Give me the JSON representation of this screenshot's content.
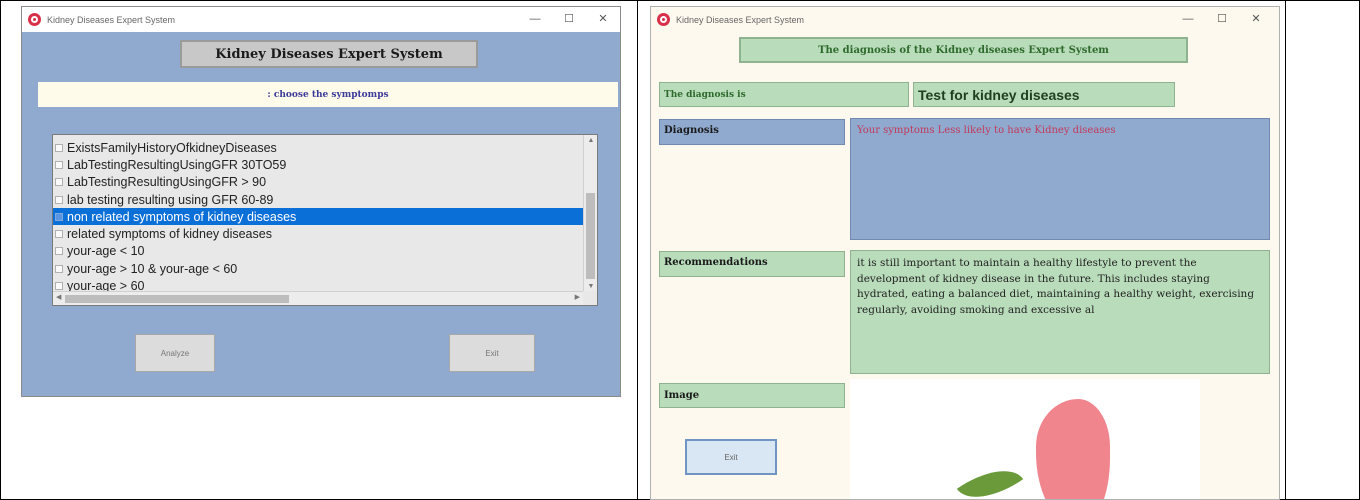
{
  "left_window": {
    "title": "Kidney Diseases Expert System",
    "controls": [
      "—",
      "☐",
      "✕"
    ],
    "heading": "Kidney Diseases Expert System",
    "prompt": ": choose the symptomps",
    "symptoms": [
      "ExistsFamilyHistoryOfkidneyDiseases",
      "LabTestingResultingUsingGFR 30TO59",
      "LabTestingResultingUsingGFR > 90",
      "lab testing resulting using GFR 60-89",
      "non related symptoms of kidney diseases",
      "related symptoms of kidney diseases",
      "your-age < 10",
      "your-age > 10 & your-age < 60",
      "your-age > 60"
    ],
    "selected_index": 4,
    "analyze_label": "Analyze",
    "exit_label": "Exit"
  },
  "right_window": {
    "title": "Kidney Diseases Expert System",
    "controls": [
      "—",
      "☐",
      "✕"
    ],
    "heading": "The diagnosis of the Kidney diseases Expert System",
    "diagnosis_is_label": "The diagnosis is",
    "diagnosis_is_value": "Test for kidney diseases",
    "diagnosis_label": "Diagnosis",
    "diagnosis_text": "Your symptoms Less likely to have Kidney diseases",
    "recommendations_label": "Recommendations",
    "recommendations_text": "it is still important to maintain a healthy lifestyle to prevent the development of kidney disease in the future. This includes staying hydrated, eating a balanced diet, maintaining a healthy weight, exercising regularly, avoiding smoking and excessive al",
    "image_label": "Image",
    "exit_label": "Exit"
  },
  "colors": {
    "panel_blue": "#8fa9cf",
    "panel_green": "#b9dcbb",
    "selection": "#0b6fd8",
    "diagnosis_text": "#c23a5a"
  }
}
